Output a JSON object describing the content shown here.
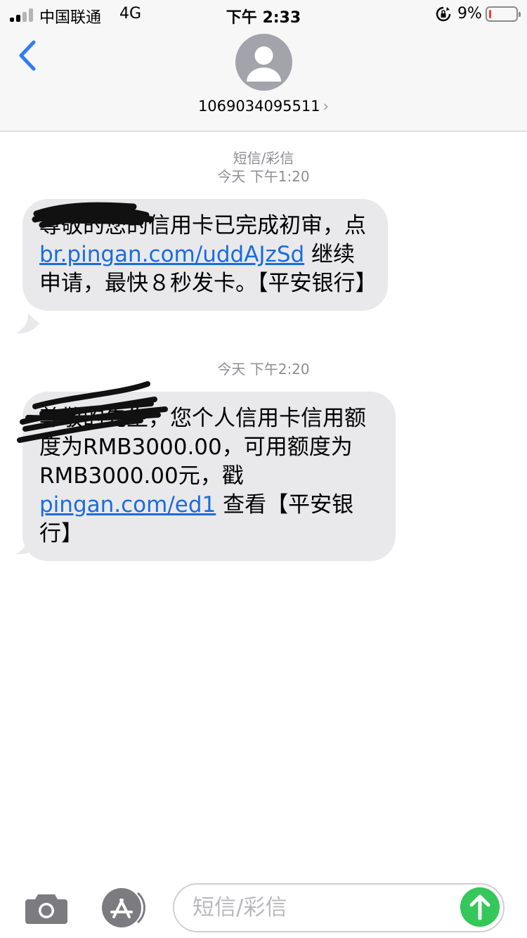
{
  "status_bar": {
    "carrier": "中国联通",
    "network": "4G",
    "time": "下午 2:33",
    "battery_percent": "9%",
    "battery_level": 0.09,
    "signal_bars": 2,
    "battery_color": "#ff3b30"
  },
  "header": {
    "contact_number": "1069034095511",
    "chevron": "›",
    "back_icon": "chevron-left-icon",
    "accent_color": "#2f7cf6"
  },
  "conversation": {
    "service_label": "短信/彩信",
    "messages": [
      {
        "timestamp": "今天 下午1:20",
        "segments": [
          {
            "text": "尊敬的您的信用卡已完成初审，点 "
          },
          {
            "text": "br.pingan.com/uddAJzSd",
            "link": true
          },
          {
            "text": " 继续申请，最快８秒发卡。【平安银行】"
          }
        ]
      },
      {
        "timestamp": "今天 下午2:20",
        "segments": [
          {
            "text": "尊敬的先生，您个人信用卡信用额度为RMB3000.00，可用额度为RMB3000.00元，戳 "
          },
          {
            "text": "pingan.com/ed1",
            "link": true
          },
          {
            "text": " 查看【平安银行】"
          }
        ]
      }
    ]
  },
  "input_bar": {
    "placeholder": "短信/彩信",
    "camera_icon": "camera-icon",
    "apps_icon": "app-store-icon",
    "send_icon": "arrow-up-icon",
    "send_color": "#34c759"
  }
}
